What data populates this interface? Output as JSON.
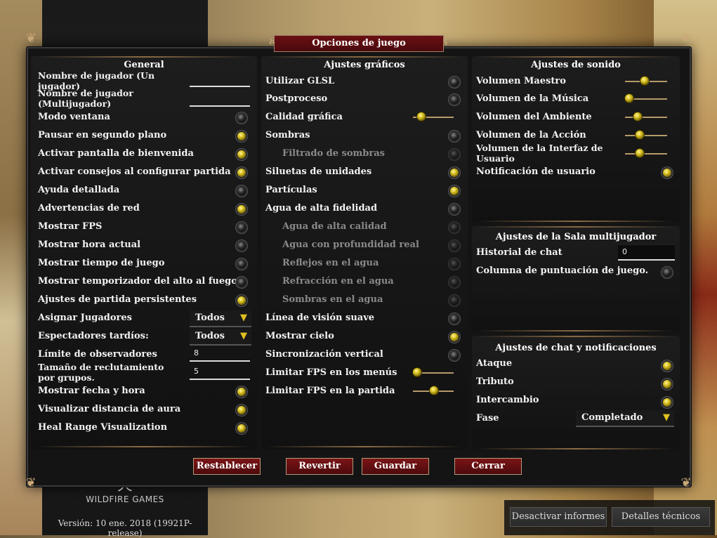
{
  "window_title": "Opciones de juego",
  "general": {
    "title": "General",
    "player_name_single": "Nombre de jugador (Un jugador)",
    "player_name_multi": "Nombre de jugador (Multijugador)",
    "windowed": "Modo ventana",
    "pause_background": "Pausar en segundo plano",
    "welcome_screen": "Activar pantalla de bienvenida",
    "setup_tips": "Activar consejos al configurar partida",
    "detailed_help": "Ayuda detallada",
    "net_warnings": "Advertencias de red",
    "show_fps": "Mostrar FPS",
    "show_clock": "Mostrar hora actual",
    "show_game_time": "Mostrar tiempo de juego",
    "ceasefire_timer": "Mostrar temporizador del alto al fuego",
    "persist_match": "Ajustes de partida persistentes",
    "assign_players": "Asignar Jugadores",
    "assign_players_value": "Todos",
    "late_observers": "Espectadores tardíos:",
    "late_observers_value": "Todos",
    "observer_limit": "Límite de observadores",
    "observer_limit_value": "8",
    "batch_size": "Tamaño de reclutamiento por grupos.",
    "batch_size_value": "5",
    "show_datetime": "Mostrar fecha y hora",
    "aura_range": "Visualizar distancia de aura",
    "heal_range": "Heal Range Visualization"
  },
  "graphics": {
    "title": "Ajustes gráficos",
    "glsl": "Utilizar GLSL",
    "postproc": "Postproceso",
    "quality": "Calidad gráfica",
    "shadows": "Sombras",
    "shadow_filter": "Filtrado de sombras",
    "silhouettes": "Siluetas de unidades",
    "particles": "Partículas",
    "water_hq": "Agua de alta fidelidad",
    "water_quality": "Agua de alta calidad",
    "water_depth": "Agua con profundidad real",
    "water_reflect": "Reflejos en el agua",
    "water_refract": "Refracción en el agua",
    "water_shadows": "Sombras en el agua",
    "smooth_los": "Línea de visión suave",
    "show_sky": "Mostrar cielo",
    "vsync": "Sincronización vertical",
    "fps_menus": "Limitar FPS en los menús",
    "fps_game": "Limitar FPS en la partida"
  },
  "sound": {
    "title": "Ajustes de sonido",
    "master": "Volumen Maestro",
    "music": "Volumen de la Música",
    "ambient": "Volumen del Ambiente",
    "action": "Volumen de la Acción",
    "ui": "Volumen de la Interfaz de Usuario",
    "notification": "Notificación de usuario"
  },
  "lobby": {
    "title": "Ajustes de la Sala multijugador",
    "chat_history": "Historial de chat",
    "chat_history_value": "0",
    "score_column": "Columna de puntuación de juego."
  },
  "chat": {
    "title": "Ajustes de chat y notificaciones",
    "attack": "Ataque",
    "tribute": "Tributo",
    "trade": "Intercambio",
    "phase": "Fase",
    "phase_value": "Completado"
  },
  "buttons": {
    "reset": "Restablecer",
    "revert": "Revertir",
    "save": "Guardar",
    "close": "Cerrar"
  },
  "background": {
    "brand": "WILDFIRE GAMES",
    "version": "Versión: 10 ene. 2018 (19921P-release)",
    "disable_reports": "Desactivar informes",
    "tech_details": "Detalles técnicos"
  },
  "colors": {
    "accent_red": "#6a0f12",
    "checkbox_on": "#d8c020",
    "border_gold": "#8a6b45"
  }
}
